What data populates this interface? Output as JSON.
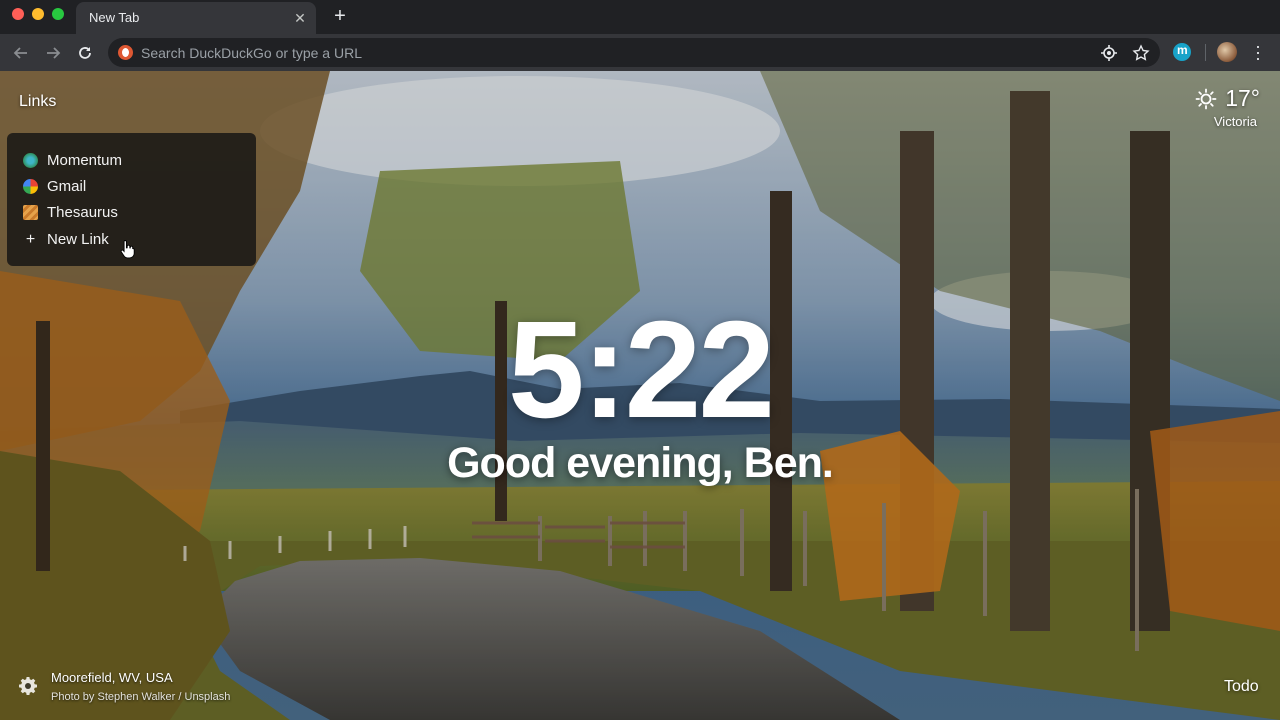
{
  "browser": {
    "tab": {
      "title": "New Tab",
      "close_glyph": "✕"
    },
    "new_tab_glyph": "+",
    "omnibox": {
      "placeholder": "Search DuckDuckGo or type a URL"
    }
  },
  "links": {
    "title": "Links",
    "items": [
      {
        "label": "Momentum",
        "icon": "momentum-icon"
      },
      {
        "label": "Gmail",
        "icon": "gmail-icon"
      },
      {
        "label": "Thesaurus",
        "icon": "thesaurus-icon"
      }
    ],
    "new_link_label": "New Link",
    "new_link_glyph": "+"
  },
  "weather": {
    "temperature": "17°",
    "location": "Victoria",
    "icon": "sun-icon"
  },
  "clock": {
    "time": "5:22"
  },
  "greeting": "Good evening, Ben.",
  "photo": {
    "location": "Moorefield, WV, USA",
    "credit": "Photo by Stephen Walker / Unsplash"
  },
  "todo_label": "Todo",
  "colors": {
    "chrome_dark": "#202124",
    "toolbar": "#35363a",
    "panel": "#141414"
  }
}
